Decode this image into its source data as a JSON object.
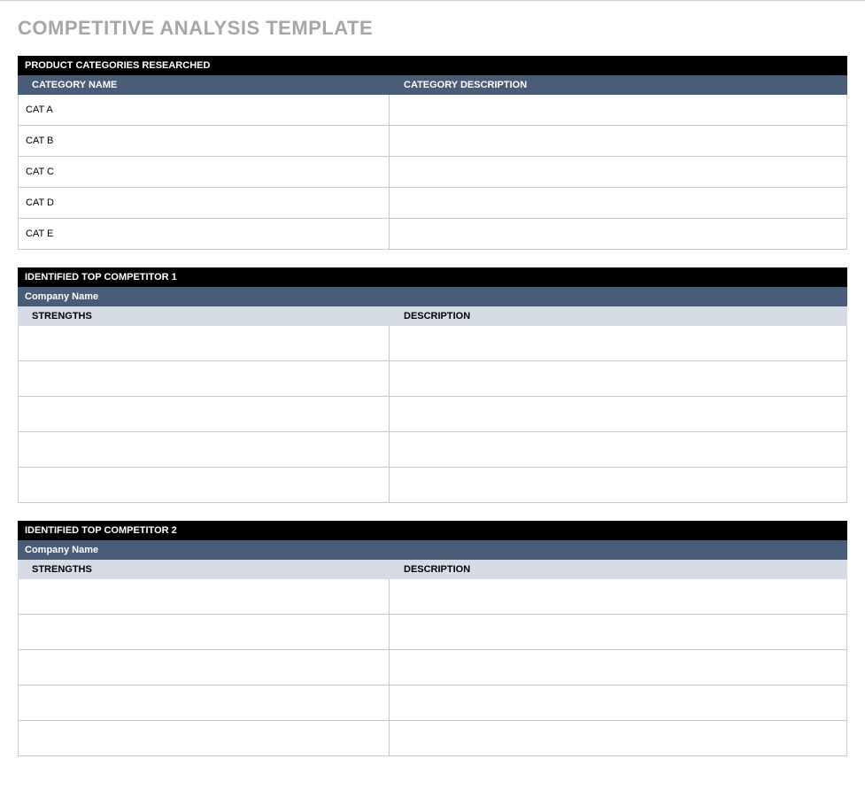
{
  "title": "COMPETITIVE ANALYSIS TEMPLATE",
  "categories": {
    "header": "PRODUCT CATEGORIES RESEARCHED",
    "col_a": "CATEGORY NAME",
    "col_b": "CATEGORY DESCRIPTION",
    "rows": [
      {
        "name": "CAT A",
        "desc": ""
      },
      {
        "name": "CAT B",
        "desc": ""
      },
      {
        "name": "CAT C",
        "desc": ""
      },
      {
        "name": "CAT D",
        "desc": ""
      },
      {
        "name": "CAT E",
        "desc": ""
      }
    ]
  },
  "competitor1": {
    "header": "IDENTIFIED TOP COMPETITOR 1",
    "company_label": "Company Name",
    "col_a": "STRENGTHS",
    "col_b": "DESCRIPTION",
    "rows": [
      {
        "strength": "",
        "desc": ""
      },
      {
        "strength": "",
        "desc": ""
      },
      {
        "strength": "",
        "desc": ""
      },
      {
        "strength": "",
        "desc": ""
      },
      {
        "strength": "",
        "desc": ""
      }
    ]
  },
  "competitor2": {
    "header": "IDENTIFIED TOP COMPETITOR 2",
    "company_label": "Company Name",
    "col_a": "STRENGTHS",
    "col_b": "DESCRIPTION",
    "rows": [
      {
        "strength": "",
        "desc": ""
      },
      {
        "strength": "",
        "desc": ""
      },
      {
        "strength": "",
        "desc": ""
      },
      {
        "strength": "",
        "desc": ""
      },
      {
        "strength": "",
        "desc": ""
      }
    ]
  }
}
